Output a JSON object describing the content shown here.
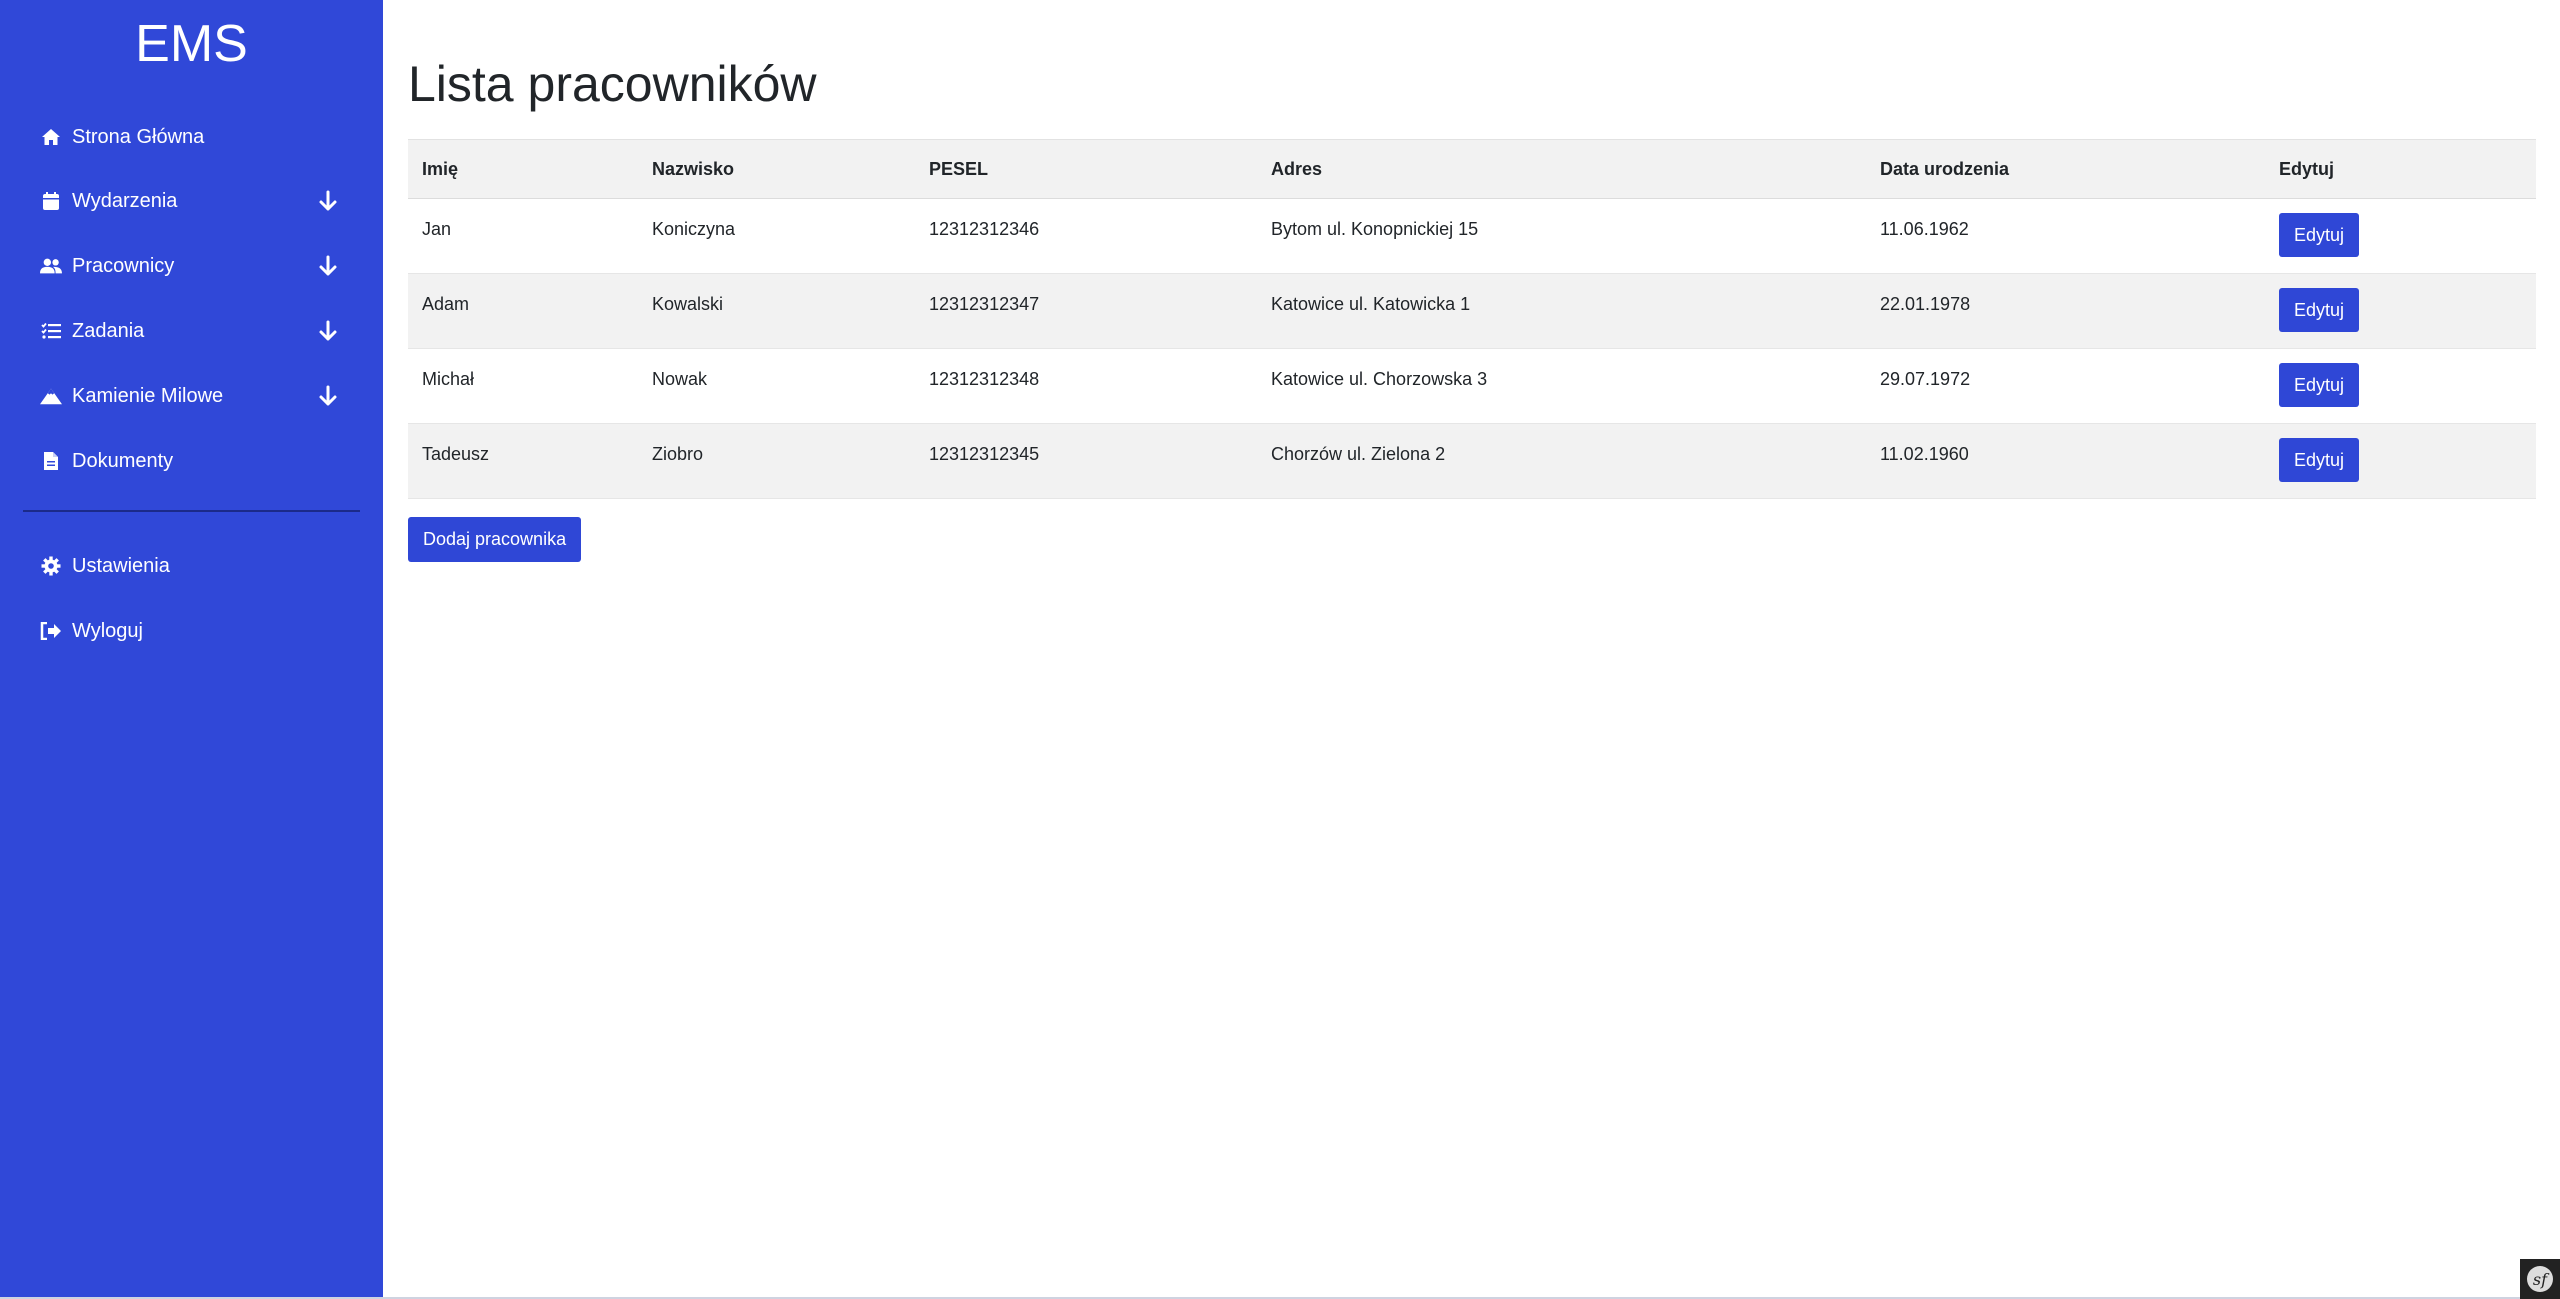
{
  "app": {
    "brand": "EMS",
    "accent_color": "#3048d8"
  },
  "sidebar": {
    "items": [
      {
        "label": "Strona Główna",
        "icon": "home-icon",
        "expandable": false
      },
      {
        "label": "Wydarzenia",
        "icon": "calendar-icon",
        "expandable": true
      },
      {
        "label": "Pracownicy",
        "icon": "users-icon",
        "expandable": true
      },
      {
        "label": "Zadania",
        "icon": "list-icon",
        "expandable": true
      },
      {
        "label": "Kamienie Milowe",
        "icon": "mountain-icon",
        "expandable": true
      },
      {
        "label": "Dokumenty",
        "icon": "document-icon",
        "expandable": false
      }
    ],
    "bottom_items": [
      {
        "label": "Ustawienia",
        "icon": "gear-icon"
      },
      {
        "label": "Wyloguj",
        "icon": "logout-icon"
      }
    ]
  },
  "main": {
    "title": "Lista pracowników",
    "table": {
      "headers": [
        "Imię",
        "Nazwisko",
        "PESEL",
        "Adres",
        "Data urodzenia",
        "Edytuj"
      ],
      "rows": [
        [
          "Jan",
          "Koniczyna",
          "12312312346",
          "Bytom ul. Konopnickiej 15",
          "11.06.1962",
          "Edytuj"
        ],
        [
          "Adam",
          "Kowalski",
          "12312312347",
          "Katowice ul. Katowicka 1",
          "22.01.1978",
          "Edytuj"
        ],
        [
          "Michał",
          "Nowak",
          "12312312348",
          "Katowice ul. Chorzowska 3",
          "29.07.1972",
          "Edytuj"
        ],
        [
          "Tadeusz",
          "Ziobro",
          "12312312345",
          "Chorzów ul. Zielona 2",
          "11.02.1960",
          "Edytuj"
        ]
      ]
    },
    "add_button": "Dodaj pracownika"
  },
  "toolbar": {
    "icon": "symfony-logo-icon",
    "label": "sf"
  }
}
